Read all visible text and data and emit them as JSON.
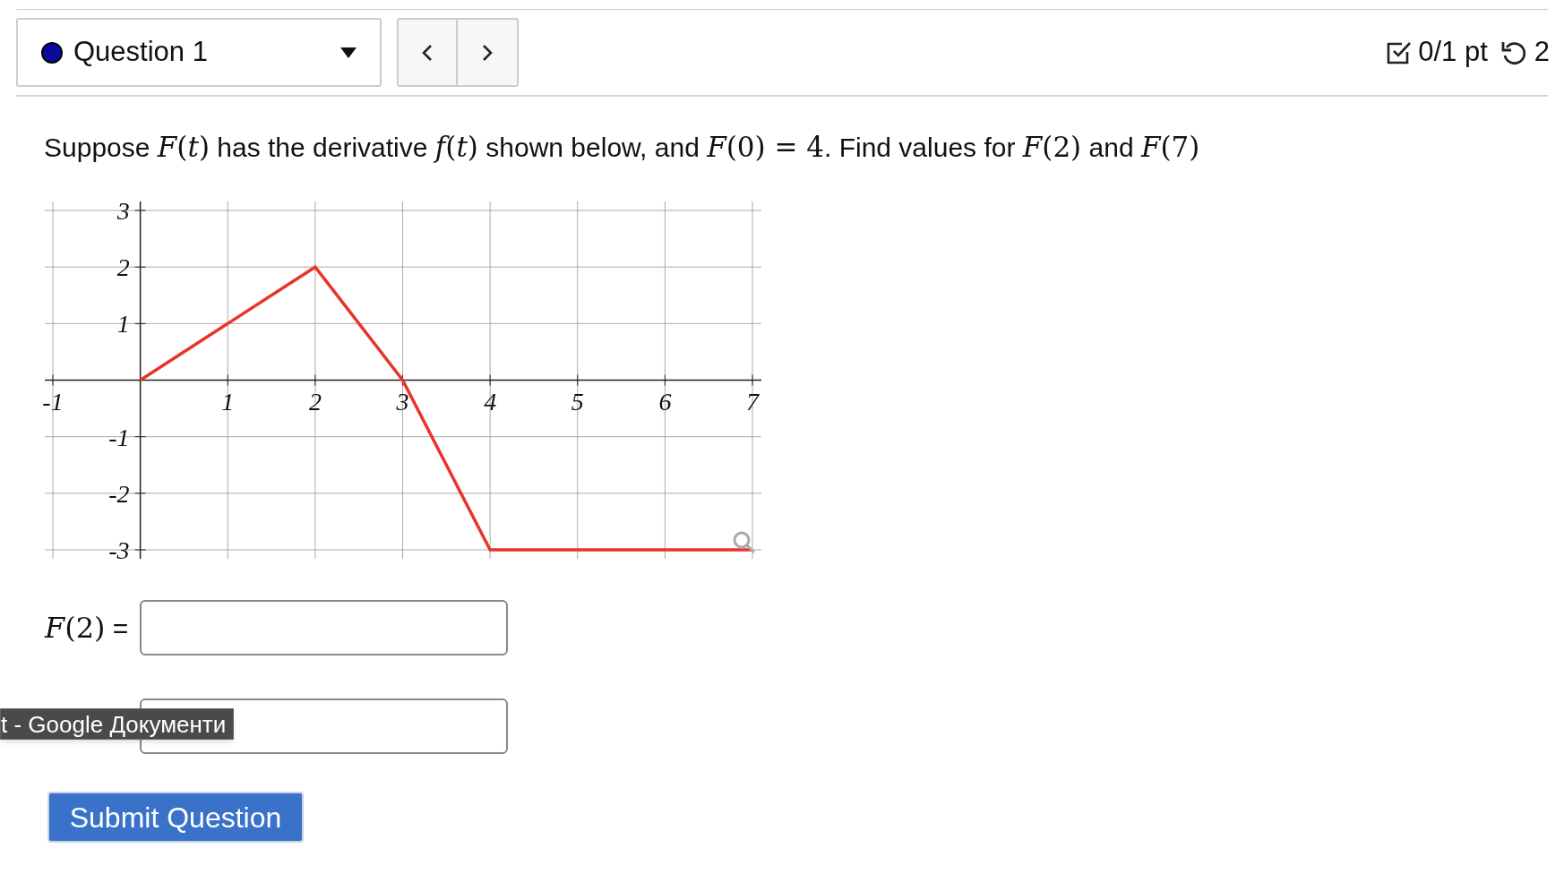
{
  "question_selector": {
    "label": "Question 1"
  },
  "score": {
    "points": "0/1 pt",
    "attempts": "2"
  },
  "question": [
    {
      "kind": "text",
      "text": "Suppose "
    },
    {
      "kind": "math",
      "text": "*F*(*t*)"
    },
    {
      "kind": "text",
      "text": " has the derivative "
    },
    {
      "kind": "math",
      "text": "*f*(*t*)"
    },
    {
      "kind": "text",
      "text": " shown below, and "
    },
    {
      "kind": "math",
      "text": "*F*(0) = 4"
    },
    {
      "kind": "text",
      "text": ". Find values for "
    },
    {
      "kind": "math",
      "text": "*F*(2)"
    },
    {
      "kind": "text",
      "text": " and "
    },
    {
      "kind": "math",
      "text": "*F*(7)"
    }
  ],
  "chart_data": {
    "type": "line",
    "x": [
      0,
      2,
      3,
      4,
      7
    ],
    "grid": true,
    "series": [
      {
        "color": "#e8352a",
        "values": [
          0,
          2,
          0,
          -3,
          -3
        ]
      }
    ],
    "xlim": [
      -1,
      7
    ],
    "ylim": [
      -3,
      3
    ],
    "xticks": [
      -1,
      1,
      2,
      3,
      4,
      5,
      6,
      7
    ],
    "yticks": [
      -3,
      -2,
      -1,
      1,
      2,
      3
    ]
  },
  "answers": [
    {
      "kind": "labeled",
      "label_math": "*F*(2)",
      "label_sign": "="
    },
    {
      "kind": "unlabeled"
    }
  ],
  "tooltip": "t - Google Документи",
  "submit_button": "Submit Question"
}
